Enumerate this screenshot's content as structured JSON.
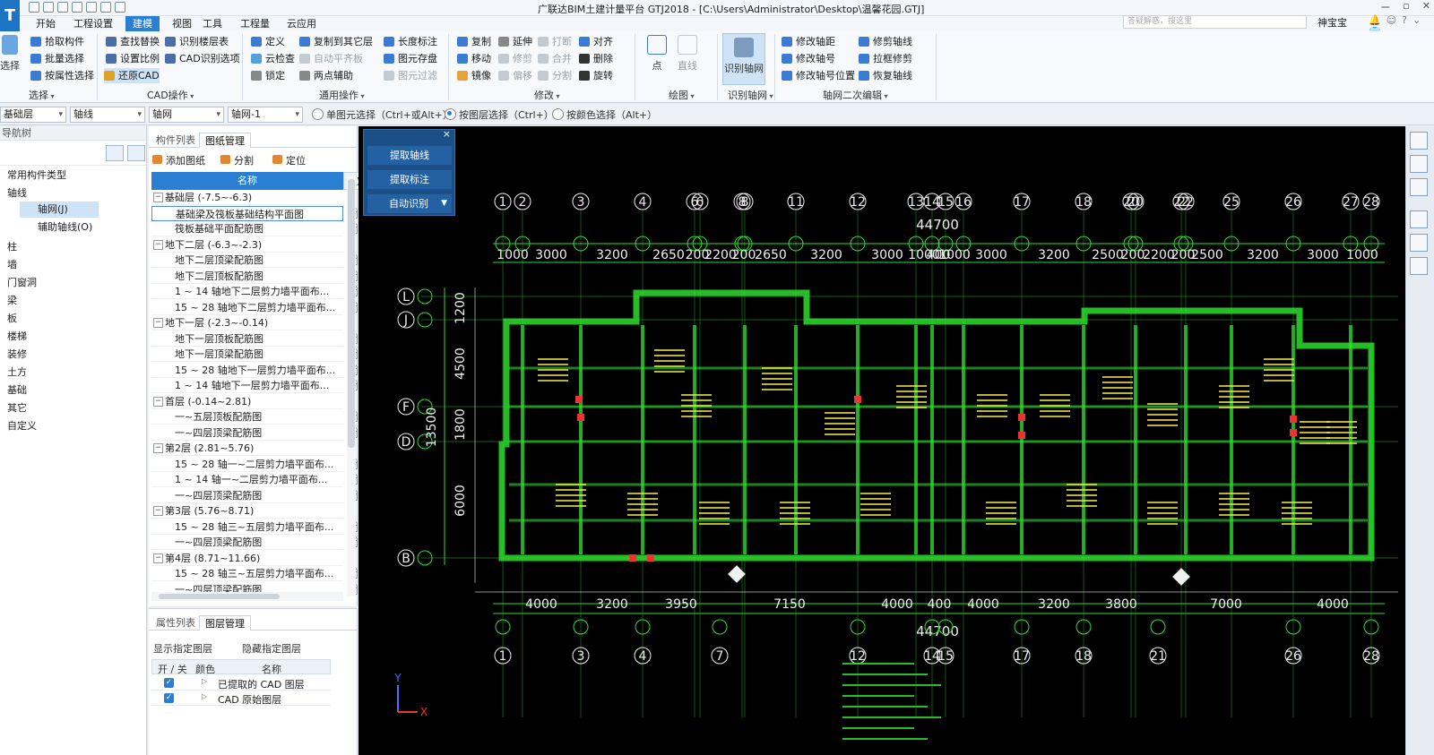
{
  "app": {
    "title": "广联达BIM土建计量平台 GTJ2018 - [C:\\Users\\Administrator\\Desktop\\温馨花园.GTJ]",
    "logo": "T",
    "search_placeholder": "答疑解惑，搜这里",
    "user": "神宝宝",
    "window_controls": [
      "ー",
      "▫",
      "✕"
    ]
  },
  "menu": [
    "开始",
    "工程设置",
    "建模",
    "视图",
    "工具",
    "工程量",
    "云应用"
  ],
  "menu_active": "建模",
  "ribbon": {
    "select_big": "选择",
    "select_items": [
      "拾取构件",
      "批量选择",
      "按属性选择"
    ],
    "group_select": "选择",
    "cad_items": [
      "查找替换",
      "设置比例",
      "还原CAD",
      "识别楼层表",
      "CAD识别选项"
    ],
    "group_cad": "CAD操作",
    "general_items": [
      "定义",
      "云检查",
      "锁定",
      "复制到其它层",
      "自动平齐板",
      "两点辅助",
      "长度标注",
      "图元存盘",
      "图元过滤"
    ],
    "group_general": "通用操作",
    "modify_items": [
      "复制",
      "移动",
      "镜像",
      "延伸",
      "修剪",
      "偏移",
      "打断",
      "合并",
      "分割",
      "对齐",
      "删除",
      "旋转"
    ],
    "group_modify": "修改",
    "draw_items": [
      "点",
      "直线"
    ],
    "group_draw": "绘图",
    "recognize_big": "识别轴网",
    "group_recognize": "识别轴网",
    "edit_items": [
      "修改轴距",
      "修改轴号",
      "修改轴号位置",
      "修剪轴线",
      "拉框修剪",
      "恢复轴线"
    ],
    "group_edit": "轴网二次编辑"
  },
  "filterbar": {
    "dropdowns": [
      "基础层",
      "轴线",
      "轴网",
      "轴网-1"
    ],
    "radios": [
      "单图元选择（Ctrl+或Alt+）",
      "按图层选择（Ctrl+）",
      "按颜色选择（Alt+）"
    ],
    "radio_selected": 1
  },
  "nav": {
    "header": "导航树",
    "items": [
      "常用构件类型",
      "轴线",
      "轴网(J)",
      "辅助轴线(O)",
      "柱",
      "墙",
      "门窗洞",
      "梁",
      "板",
      "楼梯",
      "装修",
      "土方",
      "基础",
      "其它",
      "自定义"
    ]
  },
  "drawing_panel": {
    "tabs": [
      "构件列表",
      "图纸管理"
    ],
    "tools": [
      "添加图纸",
      "分割",
      "定位"
    ],
    "col_name": "名称",
    "col_lock": "锁定",
    "rows": [
      {
        "text": "基础层 (-7.5~-6.3)",
        "group": true
      },
      {
        "text": "基础梁及筏板基础结构平面图",
        "selected": true
      },
      {
        "text": "筏板基础平面配筋图"
      },
      {
        "text": "地下二层 (-6.3~-2.3)",
        "group": true
      },
      {
        "text": "地下二层顶梁配筋图"
      },
      {
        "text": "地下二层顶板配筋图"
      },
      {
        "text": "1 ~ 14 轴地下二层剪力墙平面布..."
      },
      {
        "text": "15 ~ 28 轴地下二层剪力墙平面布..."
      },
      {
        "text": "地下一层 (-2.3~-0.14)",
        "group": true
      },
      {
        "text": "地下一层顶板配筋图"
      },
      {
        "text": "地下一层顶梁配筋图"
      },
      {
        "text": "15 ~ 28 轴地下一层剪力墙平面布..."
      },
      {
        "text": "1 ~ 14 轴地下一层剪力墙平面布..."
      },
      {
        "text": "首层 (-0.14~2.81)",
        "group": true
      },
      {
        "text": "一~五层顶板配筋图"
      },
      {
        "text": "一~四层顶梁配筋图"
      },
      {
        "text": "第2层 (2.81~5.76)",
        "group": true
      },
      {
        "text": "15 ~ 28 轴一~二层剪力墙平面布..."
      },
      {
        "text": "1 ~ 14 轴一~二层剪力墙平面布..."
      },
      {
        "text": "一~四层顶梁配筋图"
      },
      {
        "text": "第3层 (5.76~8.71)",
        "group": true
      },
      {
        "text": "15 ~ 28 轴三~五层剪力墙平面布..."
      },
      {
        "text": "一~四层顶梁配筋图"
      },
      {
        "text": "第4层 (8.71~11.66)",
        "group": true
      },
      {
        "text": "15 ~ 28 轴三~五层剪力墙平面布..."
      },
      {
        "text": "一~四层顶梁配筋图"
      }
    ]
  },
  "layer_panel": {
    "tabs": [
      "属性列表",
      "图层管理"
    ],
    "show_specified": "显示指定图层",
    "hide_specified": "隐藏指定图层",
    "columns": [
      "开 / 关",
      "颜色",
      "名称"
    ],
    "rows": [
      "已提取的 CAD 图层",
      "CAD 原始图层"
    ]
  },
  "float_panel": {
    "buttons": [
      "提取轴线",
      "提取标注",
      "自动识别"
    ],
    "close": "×"
  },
  "cad": {
    "top_axes": [
      "1",
      "2",
      "3",
      "4",
      "6",
      "6",
      "8",
      "8",
      "11",
      "12",
      "13",
      "14",
      "15",
      "16",
      "17",
      "18",
      "20",
      "20",
      "22",
      "22",
      "25",
      "26",
      "27",
      "28"
    ],
    "top_total": "44700",
    "top_dims": [
      "1000",
      "3000",
      "3200",
      "2650",
      "200",
      "2200",
      "200",
      "2650",
      "3200",
      "3000",
      "1000",
      "400",
      "1000",
      "3000",
      "3200",
      "2500",
      "200",
      "2200",
      "200",
      "2500",
      "3200",
      "3000",
      "1000"
    ],
    "bottom_dims": [
      "4000",
      "3200",
      "3950",
      "7150",
      "4000",
      "400",
      "4000",
      "3200",
      "3800",
      "7000",
      "4000"
    ],
    "bottom_total": "44700",
    "bottom_axes": [
      "1",
      "3",
      "4",
      "7",
      "12",
      "14",
      "15",
      "17",
      "18",
      "21",
      "26",
      "28"
    ],
    "left_axes": [
      "L",
      "J",
      "F",
      "D",
      "B"
    ],
    "left_dims": [
      "1200",
      "4500",
      "1800",
      "6000"
    ],
    "left_total": "13500",
    "x_label": "X",
    "y_label": "Y"
  }
}
